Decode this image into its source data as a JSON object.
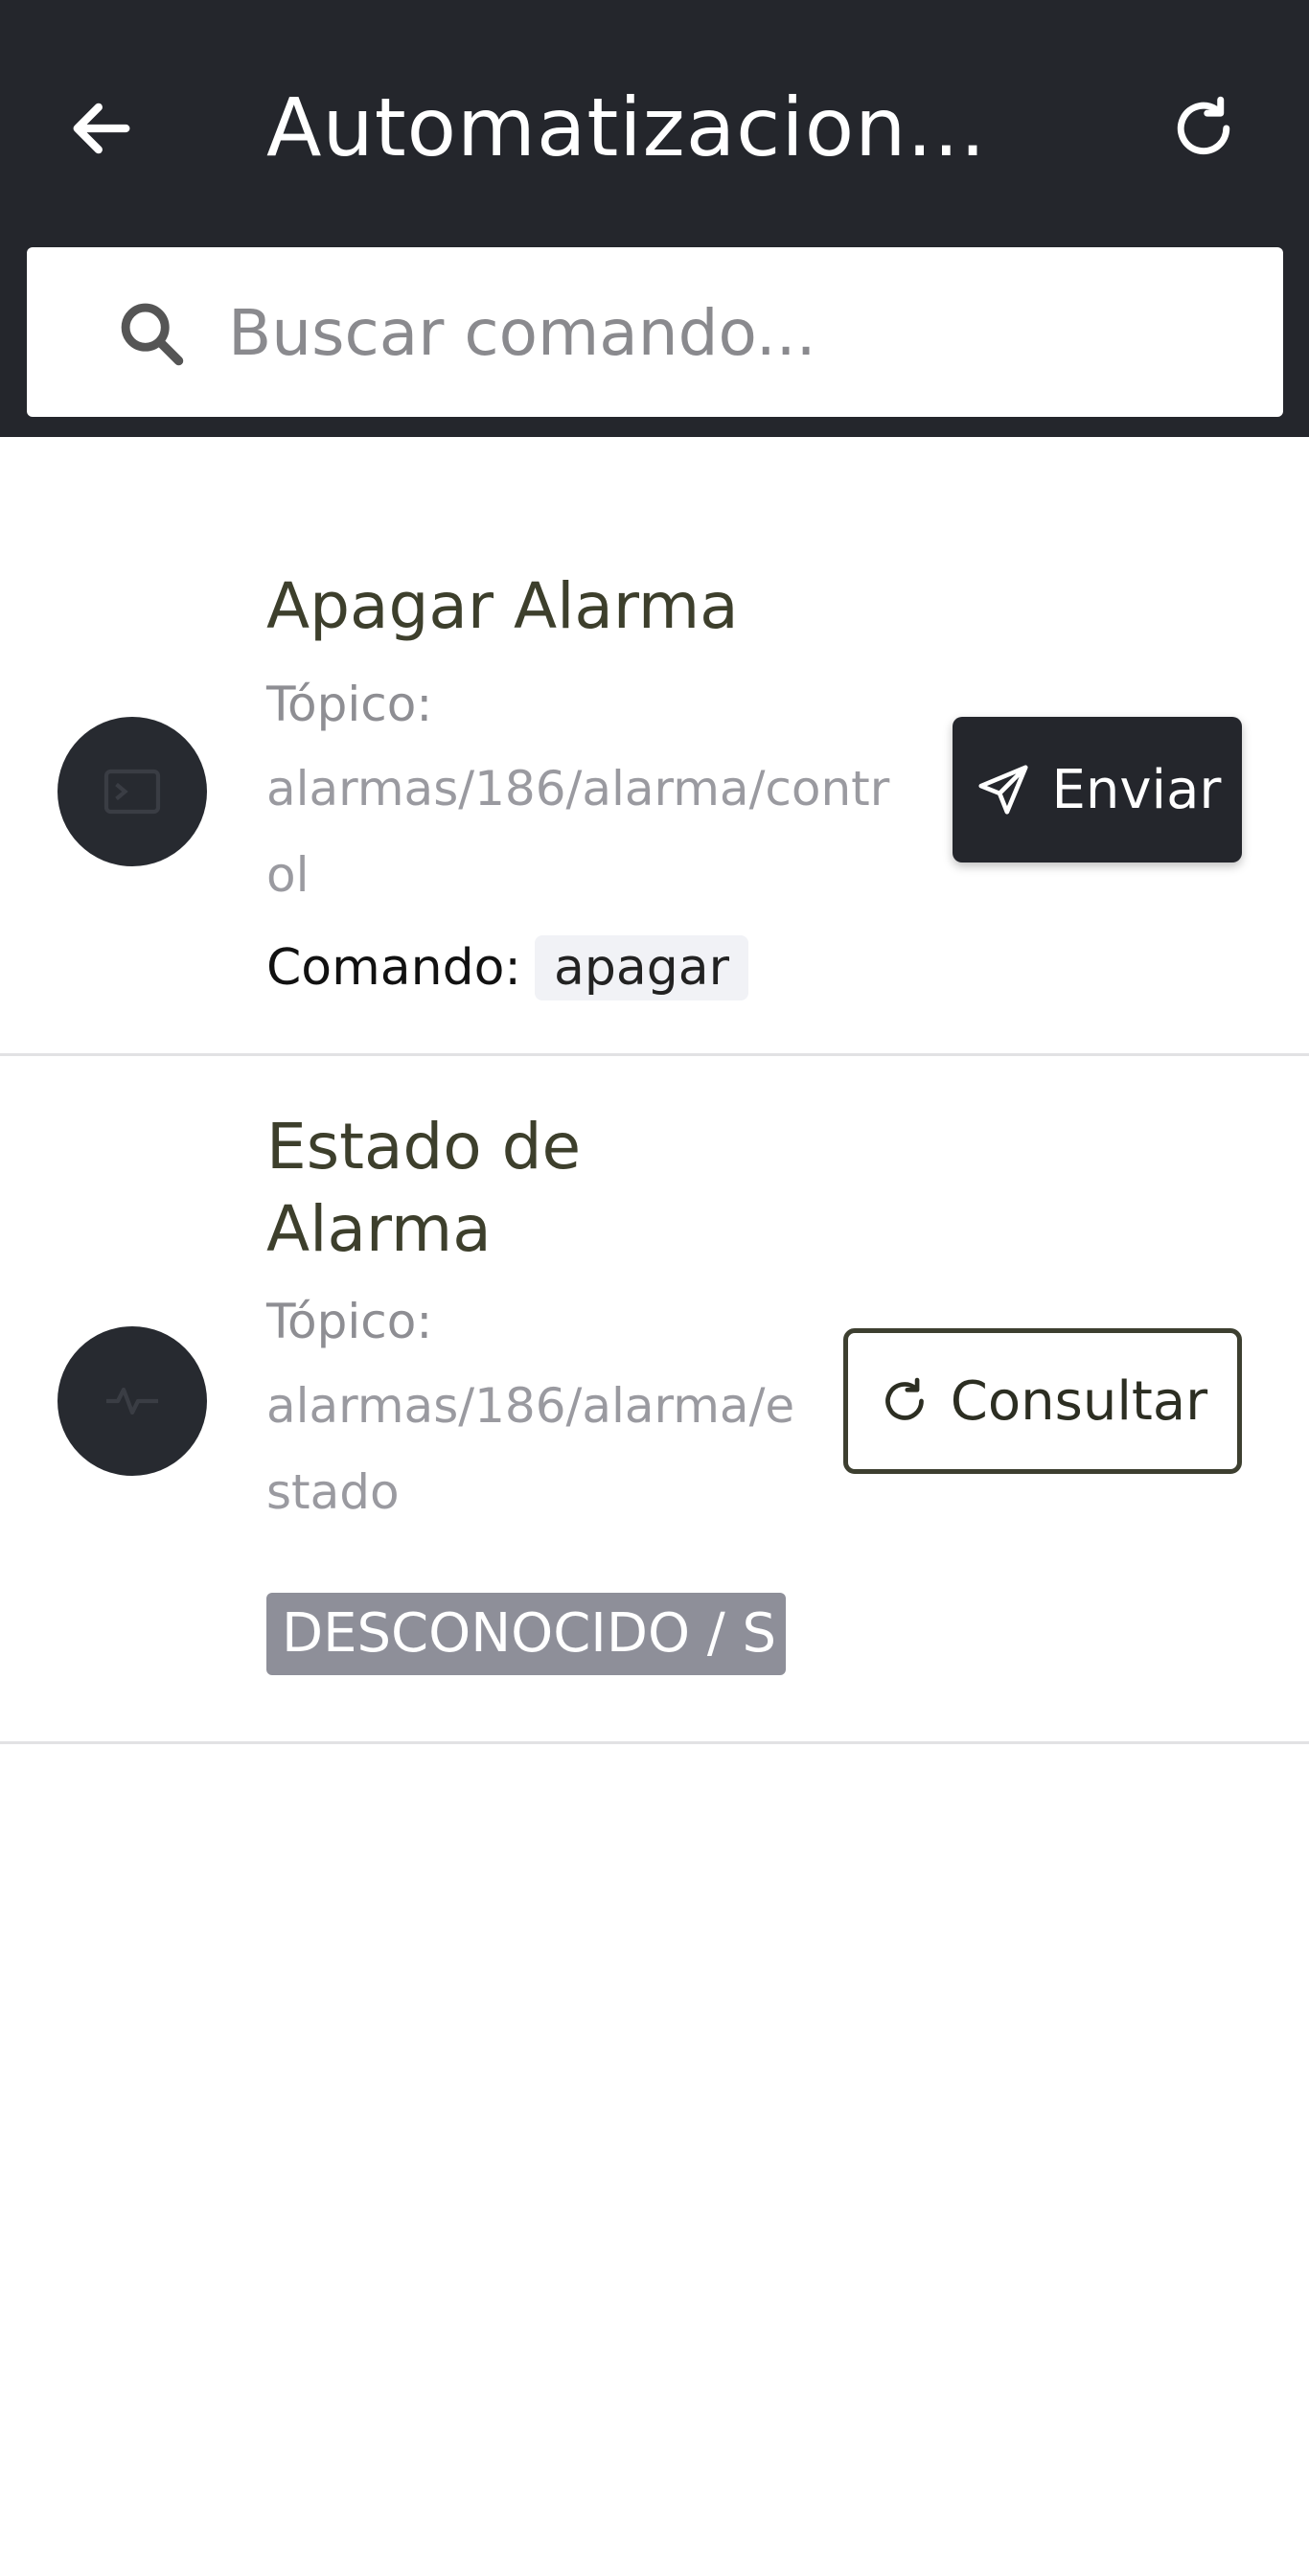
{
  "header": {
    "title": "Automatizacion...",
    "back_icon": "arrow-left-icon",
    "refresh_icon": "refresh-icon"
  },
  "search": {
    "placeholder": "Buscar comando...",
    "value": ""
  },
  "commands": [
    {
      "title": "Apagar Alarma",
      "topic_label": "Tópico:",
      "topic_value": "alarmas/186/alarma/control",
      "command_label": "Comando:",
      "command_value": "apagar",
      "button_label": "Enviar",
      "icon": "terminal-icon",
      "button_icon": "send-icon"
    },
    {
      "title": "Estado de Alarma",
      "topic_label": "Tópico:",
      "topic_value": "alarmas/186/alarma/estado",
      "status": "DESCONOCIDO / S",
      "button_label": "Consultar",
      "icon": "pulse-icon",
      "button_icon": "refresh-icon"
    }
  ],
  "colors": {
    "header_bg": "#24262c",
    "title_text": "#3d3f2c",
    "badge_bg": "#8e8f99"
  }
}
